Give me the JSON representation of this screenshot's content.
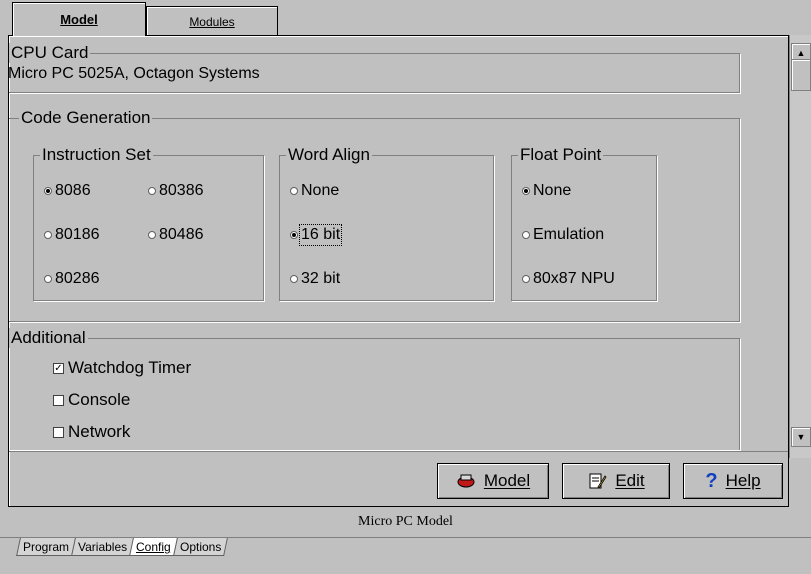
{
  "top_tabs": [
    {
      "label": "Model",
      "active": true
    },
    {
      "label": "Modules",
      "active": false
    }
  ],
  "cpu_card": {
    "title": "CPU Card",
    "value": "Micro PC 5025A, Octagon Systems"
  },
  "code_generation": {
    "title": "Code Generation",
    "instruction_set": {
      "title": "Instruction Set",
      "options": [
        {
          "label": "8086",
          "selected": true
        },
        {
          "label": "80386",
          "selected": false
        },
        {
          "label": "80186",
          "selected": false
        },
        {
          "label": "80486",
          "selected": false
        },
        {
          "label": "80286",
          "selected": false
        }
      ]
    },
    "word_align": {
      "title": "Word Align",
      "options": [
        {
          "label": "None",
          "selected": false
        },
        {
          "label": "16 bit",
          "selected": true
        },
        {
          "label": "32 bit",
          "selected": false
        }
      ]
    },
    "float_point": {
      "title": "Float Point",
      "options": [
        {
          "label": "None",
          "selected": true
        },
        {
          "label": "Emulation",
          "selected": false
        },
        {
          "label": "80x87 NPU",
          "selected": false
        }
      ]
    }
  },
  "additional": {
    "title": "Additional",
    "options": [
      {
        "label": "Watchdog Timer",
        "checked": true
      },
      {
        "label": "Console",
        "checked": false
      },
      {
        "label": "Network",
        "checked": false
      }
    ]
  },
  "buttons": {
    "model": "Model",
    "edit": "Edit",
    "help": "Help",
    "help_icon": "?"
  },
  "status_bar": "Micro PC Model",
  "bottom_tabs": [
    {
      "label": "Program",
      "active": false
    },
    {
      "label": "Variables",
      "active": false
    },
    {
      "label": "Config",
      "active": true
    },
    {
      "label": "Options",
      "active": false
    }
  ],
  "icons": {
    "model_button": "chip-icon",
    "edit_button": "edit-pencil-icon",
    "help_button": "question-icon",
    "scroll_up": "arrow-up-icon",
    "scroll_down": "arrow-down-icon"
  },
  "colors": {
    "background": "#c0c0c0",
    "help_icon": "#1040c0",
    "chip_icon": "#c01818"
  }
}
